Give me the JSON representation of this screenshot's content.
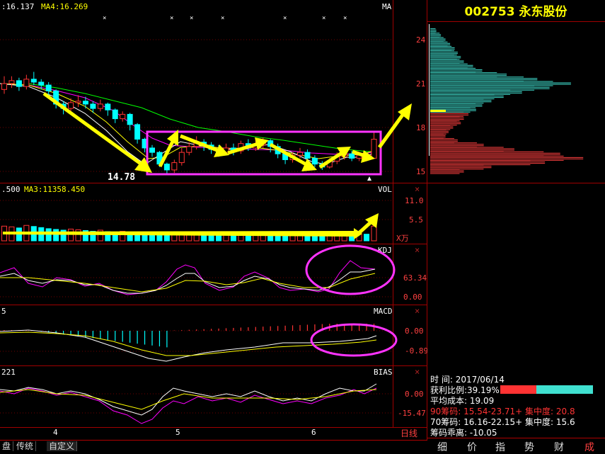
{
  "stock": {
    "code": "002753",
    "name": "永东股份"
  },
  "panels": {
    "price": {
      "legend_a": ":16.137",
      "legend_b": "MA4:16.269",
      "tag": "MA",
      "low_label": "14.78",
      "axis": [
        "24",
        "21",
        "18",
        "15"
      ]
    },
    "volume": {
      "legend_a": ".500",
      "legend_b": "MA3:11358.450",
      "tag": "VOL",
      "axis": [
        "11.0",
        "5.5"
      ],
      "unit": "X万"
    },
    "kdj": {
      "tag": "KDJ",
      "axis": [
        "63.34",
        "0.00"
      ]
    },
    "macd": {
      "legend": "5",
      "tag": "MACD",
      "axis": [
        "0.00",
        "-0.89"
      ]
    },
    "bias": {
      "legend": "221",
      "tag": "BIAS",
      "axis": [
        "0.00",
        "-15.47"
      ]
    }
  },
  "x_axis_labels": [
    "4",
    "5",
    "6"
  ],
  "period": "日线",
  "bottom_tabs": [
    "盘",
    "传统",
    "自定义"
  ],
  "chips": {
    "time_label": "时        间:",
    "time_value": "2017/06/14",
    "profit_label": "获利比例:",
    "profit_value": "39.19%",
    "avg_cost": "平均成本: 19.09",
    "chip90": "90筹码: 15.54-23.71+ 集中度: 20.8",
    "chip70": "70筹码: 16.16-22.15+ 集中度: 15.6",
    "bias": "筹码乖离: -10.05",
    "profit_fraction": 0.3919
  },
  "side_tabs": [
    "细",
    "价",
    "指",
    "势",
    "财",
    "成"
  ],
  "colors": {
    "up": "#ff3333",
    "down": "#00ffff",
    "ma_white": "#ffffff",
    "ma_yellow": "#ffff00",
    "ma_magenta": "#ff00ff",
    "ma_green": "#00ff00",
    "arrow": "#ffff00",
    "highlight": "#ff33ff",
    "chip_profit": "#ff4040",
    "chip_loss": "#40e0d0"
  },
  "chart_data": {
    "type": "candlestick",
    "y_range": [
      14.5,
      25.5
    ],
    "candles": [
      [
        20.6,
        21.0,
        21.5,
        20.3
      ],
      [
        21.0,
        21.2,
        21.5,
        20.7
      ],
      [
        21.2,
        20.8,
        21.4,
        20.5
      ],
      [
        20.8,
        21.3,
        21.6,
        20.6
      ],
      [
        21.3,
        21.1,
        21.8,
        20.9
      ],
      [
        21.1,
        20.9,
        21.3,
        20.6
      ],
      [
        20.9,
        20.5,
        21.1,
        20.2
      ],
      [
        20.5,
        19.6,
        20.6,
        19.3
      ],
      [
        19.6,
        19.3,
        19.8,
        18.9
      ],
      [
        19.3,
        19.7,
        20.0,
        19.0
      ],
      [
        19.7,
        19.8,
        20.2,
        19.4
      ],
      [
        19.8,
        19.6,
        20.1,
        19.3
      ],
      [
        19.6,
        19.3,
        19.8,
        19.0
      ],
      [
        19.3,
        19.6,
        19.9,
        19.1
      ],
      [
        19.6,
        19.2,
        19.7,
        18.8
      ],
      [
        19.2,
        18.6,
        19.3,
        18.3
      ],
      [
        18.6,
        18.9,
        19.1,
        18.4
      ],
      [
        18.9,
        18.2,
        19.0,
        17.8
      ],
      [
        18.2,
        17.2,
        18.3,
        16.9
      ],
      [
        17.2,
        16.6,
        17.3,
        16.3
      ],
      [
        16.6,
        16.3,
        16.8,
        16.0
      ],
      [
        16.3,
        15.5,
        16.4,
        15.3
      ],
      [
        15.5,
        15.1,
        15.6,
        14.78
      ],
      [
        15.1,
        15.6,
        15.8,
        14.9
      ],
      [
        15.6,
        16.3,
        16.6,
        15.4
      ],
      [
        16.3,
        16.7,
        17.0,
        16.1
      ],
      [
        16.7,
        17.0,
        17.4,
        16.5
      ],
      [
        17.0,
        16.8,
        17.2,
        16.4
      ],
      [
        16.8,
        16.5,
        17.0,
        16.2
      ],
      [
        16.5,
        16.3,
        16.8,
        16.0
      ],
      [
        16.3,
        16.6,
        16.9,
        16.1
      ],
      [
        16.6,
        16.4,
        16.9,
        16.1
      ],
      [
        16.4,
        16.9,
        17.1,
        16.2
      ],
      [
        16.9,
        16.6,
        17.2,
        16.4
      ],
      [
        16.6,
        16.8,
        17.1,
        16.4
      ],
      [
        16.8,
        17.1,
        17.3,
        16.6
      ],
      [
        17.1,
        16.7,
        17.2,
        16.3
      ],
      [
        16.7,
        16.2,
        16.9,
        15.9
      ],
      [
        16.2,
        15.8,
        16.4,
        15.5
      ],
      [
        15.8,
        16.1,
        16.3,
        15.6
      ],
      [
        16.1,
        16.3,
        16.6,
        15.9
      ],
      [
        16.3,
        15.9,
        16.5,
        15.7
      ],
      [
        15.9,
        15.5,
        16.1,
        15.3
      ],
      [
        15.5,
        15.3,
        15.7,
        15.1
      ],
      [
        15.3,
        15.7,
        15.9,
        15.2
      ],
      [
        15.7,
        16.0,
        16.3,
        15.5
      ],
      [
        16.0,
        16.2,
        16.5,
        15.8
      ],
      [
        16.2,
        15.9,
        16.4,
        15.7
      ],
      [
        15.9,
        16.1,
        16.3,
        15.7
      ],
      [
        16.1,
        15.9,
        16.3,
        15.7
      ],
      [
        15.9,
        17.2,
        17.7,
        15.9
      ]
    ],
    "volume": [
      4.0,
      3.8,
      3.5,
      4.2,
      3.9,
      3.6,
      3.3,
      3.1,
      2.9,
      3.2,
      3.0,
      2.8,
      2.6,
      2.9,
      2.5,
      2.4,
      2.6,
      2.3,
      2.2,
      2.1,
      2.0,
      1.9,
      2.0,
      2.2,
      2.4,
      2.3,
      2.1,
      2.0,
      1.9,
      2.0,
      2.1,
      1.9,
      2.0,
      1.8,
      1.9,
      2.0,
      1.8,
      1.7,
      1.7,
      1.8,
      1.9,
      1.8,
      1.7,
      1.6,
      1.8,
      1.9,
      2.0,
      1.8,
      1.9,
      1.8,
      4.0
    ],
    "chip_distribution": {
      "price": [
        15.0,
        15.3,
        15.6,
        15.9,
        16.2,
        16.5,
        16.8,
        17.1,
        17.4,
        17.7,
        18.0,
        18.3,
        18.6,
        18.9,
        19.2,
        19.5,
        19.8,
        20.1,
        20.4,
        20.7,
        21.0,
        21.3,
        21.6,
        21.9,
        22.2,
        22.5,
        22.8,
        23.1,
        23.4,
        23.7,
        24.0,
        24.3,
        24.6
      ],
      "amount": [
        0.22,
        0.4,
        0.75,
        1.0,
        0.85,
        0.55,
        0.35,
        0.18,
        0.1,
        0.12,
        0.15,
        0.2,
        0.22,
        0.25,
        0.3,
        0.34,
        0.4,
        0.48,
        0.6,
        0.78,
        0.92,
        0.7,
        0.5,
        0.34,
        0.28,
        0.22,
        0.2,
        0.18,
        0.16,
        0.13,
        0.1,
        0.07,
        0.04
      ]
    }
  }
}
